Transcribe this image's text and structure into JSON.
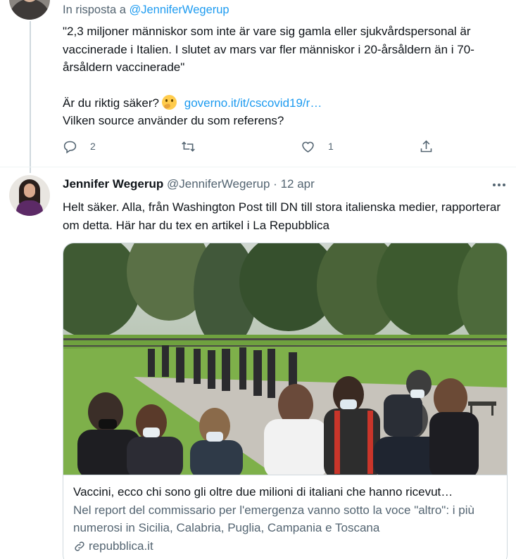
{
  "reply_tweet": {
    "reply_prefix": "In risposta a",
    "reply_mention": "@JenniferWegerup",
    "paragraph1": "\"2,3 miljoner människor som inte är vare sig gamla eller sjukvårdspersonal är vaccinerade i Italien. I slutet av mars var fler människor i 20-årsåldern än i 70-årsåldern vaccinerade\"",
    "question": "Är du riktig säker?",
    "emoji": "thinking-face-emoji",
    "link": "governo.it/it/cscovid19/r…",
    "line3": "Vilken source använder du som referens?",
    "actions": {
      "reply_count": "2",
      "retweet_count": "",
      "like_count": "1"
    }
  },
  "main_tweet": {
    "name": "Jennifer Wegerup",
    "handle": "@JenniferWegerup",
    "separator": "·",
    "date": "12 apr",
    "text": "Helt säker. Alla, från Washington Post till DN till stora italienska medier, rapporterar om detta. Här har du tex en artikel i La Repubblica",
    "card": {
      "title": "Vaccini, ecco chi sono gli oltre due milioni di italiani che hanno ricevut…",
      "description": "Nel report del commissario per l'emergenza vanno sotto la voce \"altro\": i più numerosi in Sicilia, Calabria, Puglia, Campania e Toscana",
      "domain": "repubblica.it"
    }
  },
  "colors": {
    "accent": "#1d9bf0",
    "secondary_text": "#536471",
    "border": "#cfd9de"
  }
}
